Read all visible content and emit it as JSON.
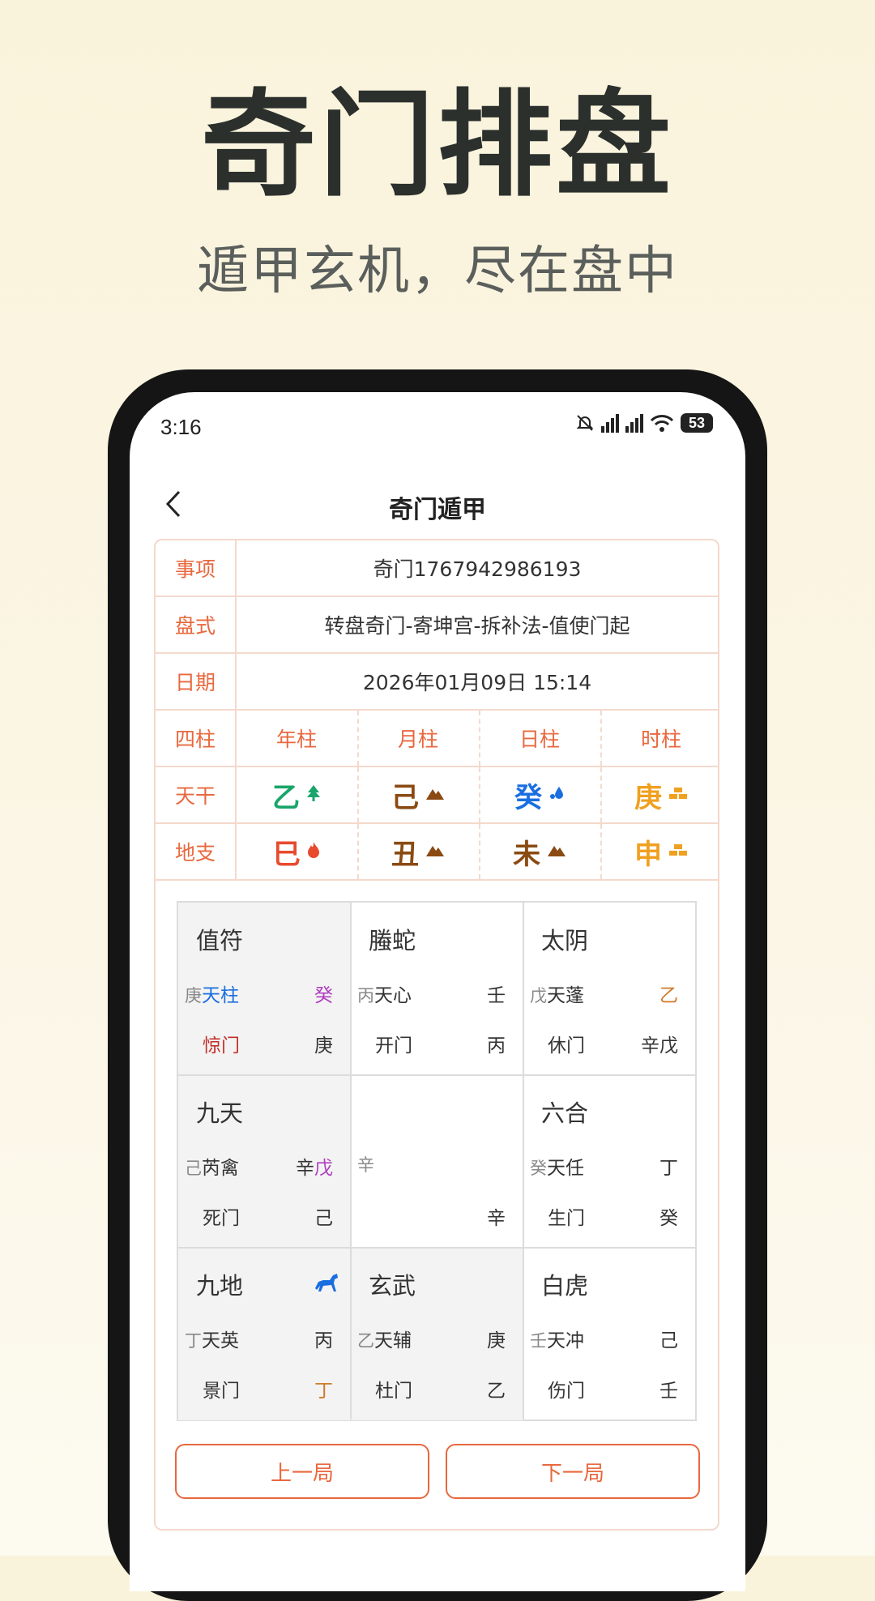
{
  "hero": {
    "title": "奇门排盘",
    "subtitle": "遁甲玄机，尽在盘中"
  },
  "status_bar": {
    "time": "3:16",
    "battery": "53"
  },
  "nav": {
    "title": "奇门遁甲"
  },
  "info": {
    "event_label": "事项",
    "event_value": "奇门1767942986193",
    "style_label": "盘式",
    "style_value": "转盘奇门-寄坤宫-拆补法-值使门起",
    "date_label": "日期",
    "date_value": "2026年01月09日 15:14"
  },
  "pillars": {
    "label": "四柱",
    "headers": [
      "年柱",
      "月柱",
      "日柱",
      "时柱"
    ],
    "stem_label": "天干",
    "stems": [
      {
        "char": "乙",
        "color": "#1aa56a",
        "icon": "tree-icon"
      },
      {
        "char": "己",
        "color": "#8a4a12",
        "icon": "mountain-icon"
      },
      {
        "char": "癸",
        "color": "#1a6fe0",
        "icon": "water-drop-icon"
      },
      {
        "char": "庚",
        "color": "#f0a020",
        "icon": "gold-icon"
      }
    ],
    "branch_label": "地支",
    "branches": [
      {
        "char": "巳",
        "color": "#e84a2e",
        "icon": "fire-icon"
      },
      {
        "char": "丑",
        "color": "#8a4a12",
        "icon": "mountain-icon"
      },
      {
        "char": "未",
        "color": "#8a4a12",
        "icon": "mountain-icon"
      },
      {
        "char": "申",
        "color": "#f0a020",
        "icon": "gold-icon"
      }
    ]
  },
  "palaces": [
    {
      "god": "值符",
      "pre": "庚",
      "star": "天柱",
      "star_color": "#1a6fe0",
      "r1": "癸",
      "r1_color": "#b03fc0",
      "door": "惊门",
      "door_color": "#c0302a",
      "r2": "庚",
      "shaded": true
    },
    {
      "god": "螣蛇",
      "pre": "丙",
      "star": "天心",
      "r1": "壬",
      "door": "开门",
      "r2": "丙",
      "shaded": false
    },
    {
      "god": "太阴",
      "pre": "戊",
      "star": "天蓬",
      "r1": "乙",
      "r1_color": "#d07a2a",
      "door": "休门",
      "r2": "辛戊",
      "shaded": false
    },
    {
      "god": "九天",
      "pre": "己",
      "star": "芮禽",
      "r1a": "辛",
      "r1b": "戊",
      "r1b_color": "#b03fc0",
      "door": "死门",
      "r2": "己",
      "shaded": true
    },
    {
      "god": "",
      "pre": "辛",
      "star": "",
      "r1": "",
      "door": "",
      "r2": "辛",
      "shaded": false
    },
    {
      "god": "六合",
      "pre": "癸",
      "star": "天任",
      "r1": "丁",
      "door": "生门",
      "r2": "癸",
      "shaded": false
    },
    {
      "god": "九地",
      "pre": "丁",
      "star": "天英",
      "r1": "丙",
      "door": "景门",
      "r2": "丁",
      "r2_color": "#d07a2a",
      "icon": "horse-icon",
      "shaded": true
    },
    {
      "god": "玄武",
      "pre": "乙",
      "star": "天辅",
      "r1": "庚",
      "door": "杜门",
      "r2": "乙",
      "shaded": true
    },
    {
      "god": "白虎",
      "pre": "壬",
      "star": "天冲",
      "r1": "己",
      "door": "伤门",
      "r2": "壬",
      "shaded": false
    }
  ],
  "buttons": {
    "prev": "上一局",
    "next": "下一局"
  },
  "colors": {
    "accent": "#e8683e",
    "border": "#f4d9cc"
  }
}
